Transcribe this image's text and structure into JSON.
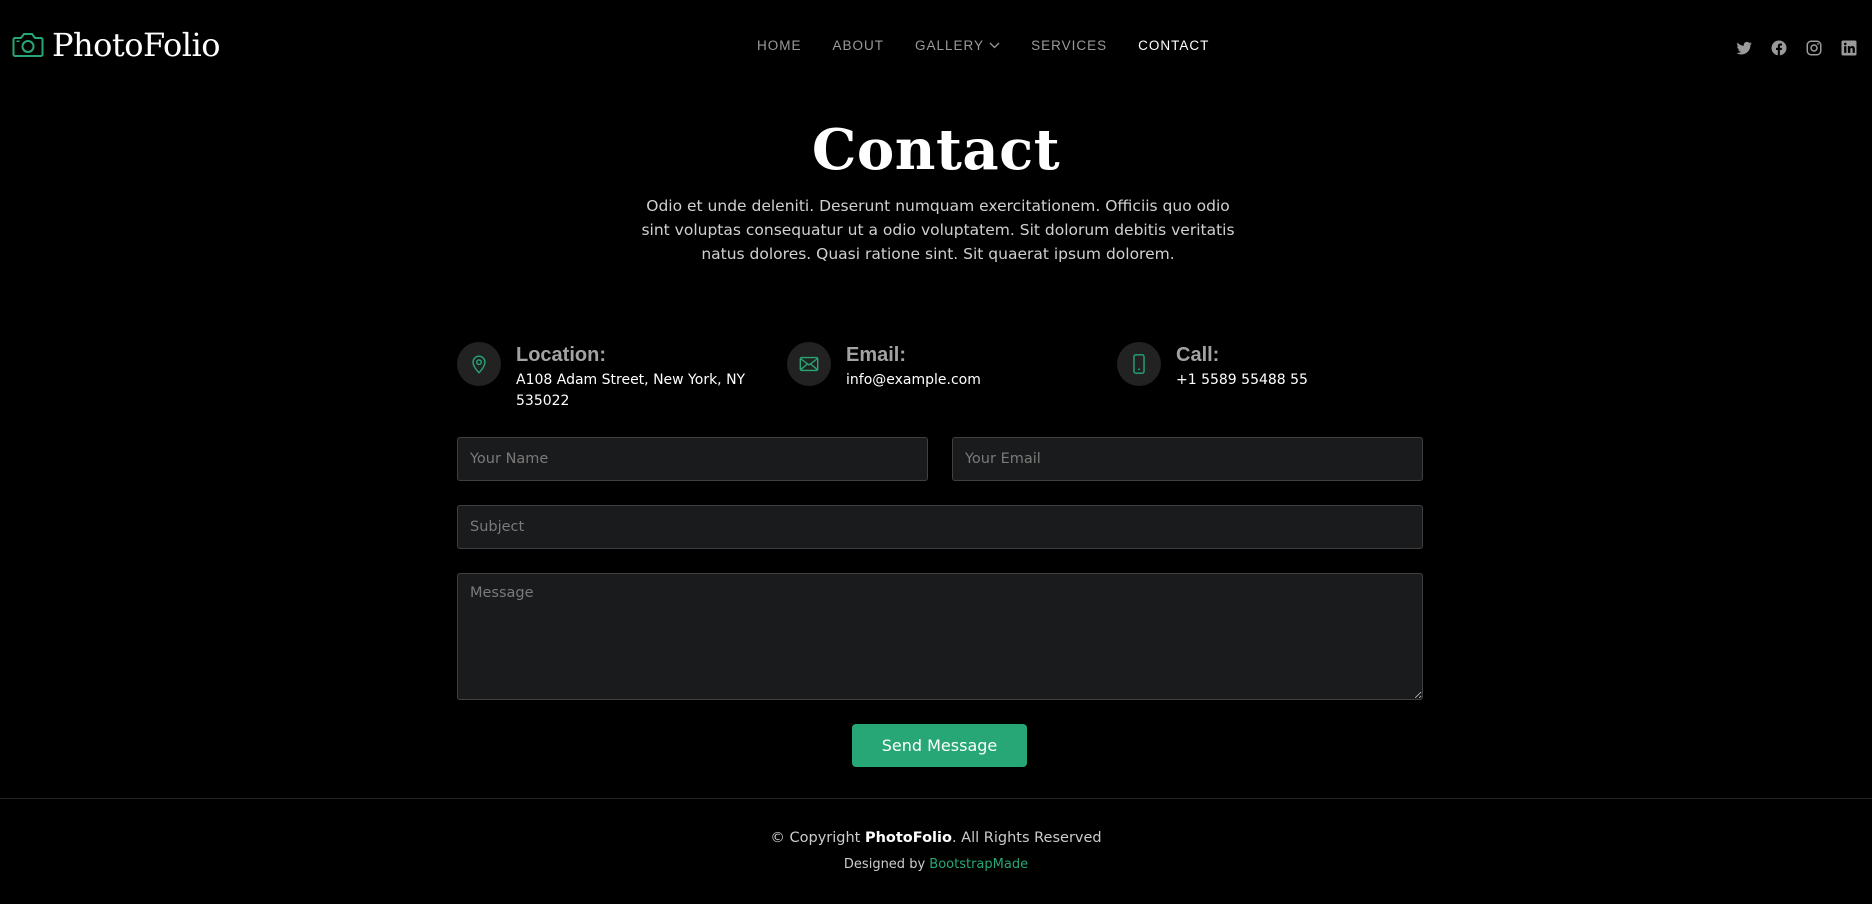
{
  "brand": {
    "name": "PhotoFolio",
    "accent_color": "#27a776"
  },
  "nav": {
    "items": [
      {
        "label": "HOME"
      },
      {
        "label": "ABOUT"
      },
      {
        "label": "GALLERY"
      },
      {
        "label": "SERVICES"
      },
      {
        "label": "CONTACT",
        "active": true
      }
    ]
  },
  "socials": [
    "twitter-icon",
    "facebook-icon",
    "instagram-icon",
    "linkedin-icon"
  ],
  "hero": {
    "title": "Contact",
    "description": "Odio et unde deleniti. Deserunt numquam exercitationem. Officiis quo odio sint voluptas consequatur ut a odio voluptatem. Sit dolorum debitis veritatis natus dolores. Quasi ratione sint. Sit quaerat ipsum dolorem."
  },
  "info": {
    "location": {
      "label": "Location:",
      "value_line1": "A108 Adam Street, New York, NY",
      "value_line2": "535022"
    },
    "email": {
      "label": "Email:",
      "value": "info@example.com"
    },
    "call": {
      "label": "Call:",
      "value": "+1 5589 55488 55"
    }
  },
  "form": {
    "name_placeholder": "Your Name",
    "email_placeholder": "Your Email",
    "subject_placeholder": "Subject",
    "message_placeholder": "Message",
    "submit_label": "Send Message"
  },
  "footer": {
    "copyright_prefix": "© Copyright ",
    "copyright_brand": "PhotoFolio",
    "copyright_suffix": ". All Rights Reserved",
    "designed_by": "Designed by ",
    "designer": "BootstrapMade"
  }
}
